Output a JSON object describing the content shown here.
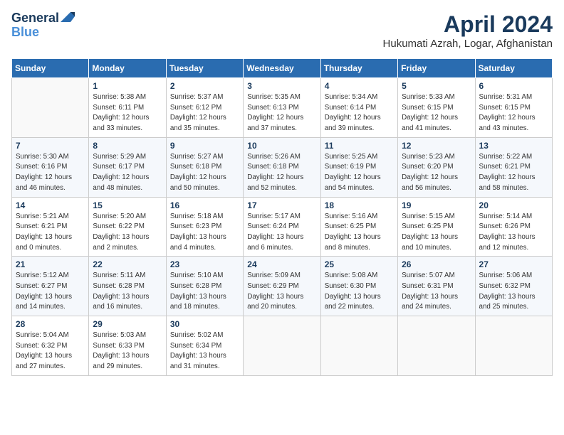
{
  "logo": {
    "line1": "General",
    "line2": "Blue"
  },
  "title": "April 2024",
  "location": "Hukumati Azrah, Logar, Afghanistan",
  "weekdays": [
    "Sunday",
    "Monday",
    "Tuesday",
    "Wednesday",
    "Thursday",
    "Friday",
    "Saturday"
  ],
  "weeks": [
    [
      {
        "day": "",
        "info": ""
      },
      {
        "day": "1",
        "info": "Sunrise: 5:38 AM\nSunset: 6:11 PM\nDaylight: 12 hours\nand 33 minutes."
      },
      {
        "day": "2",
        "info": "Sunrise: 5:37 AM\nSunset: 6:12 PM\nDaylight: 12 hours\nand 35 minutes."
      },
      {
        "day": "3",
        "info": "Sunrise: 5:35 AM\nSunset: 6:13 PM\nDaylight: 12 hours\nand 37 minutes."
      },
      {
        "day": "4",
        "info": "Sunrise: 5:34 AM\nSunset: 6:14 PM\nDaylight: 12 hours\nand 39 minutes."
      },
      {
        "day": "5",
        "info": "Sunrise: 5:33 AM\nSunset: 6:15 PM\nDaylight: 12 hours\nand 41 minutes."
      },
      {
        "day": "6",
        "info": "Sunrise: 5:31 AM\nSunset: 6:15 PM\nDaylight: 12 hours\nand 43 minutes."
      }
    ],
    [
      {
        "day": "7",
        "info": "Sunrise: 5:30 AM\nSunset: 6:16 PM\nDaylight: 12 hours\nand 46 minutes."
      },
      {
        "day": "8",
        "info": "Sunrise: 5:29 AM\nSunset: 6:17 PM\nDaylight: 12 hours\nand 48 minutes."
      },
      {
        "day": "9",
        "info": "Sunrise: 5:27 AM\nSunset: 6:18 PM\nDaylight: 12 hours\nand 50 minutes."
      },
      {
        "day": "10",
        "info": "Sunrise: 5:26 AM\nSunset: 6:18 PM\nDaylight: 12 hours\nand 52 minutes."
      },
      {
        "day": "11",
        "info": "Sunrise: 5:25 AM\nSunset: 6:19 PM\nDaylight: 12 hours\nand 54 minutes."
      },
      {
        "day": "12",
        "info": "Sunrise: 5:23 AM\nSunset: 6:20 PM\nDaylight: 12 hours\nand 56 minutes."
      },
      {
        "day": "13",
        "info": "Sunrise: 5:22 AM\nSunset: 6:21 PM\nDaylight: 12 hours\nand 58 minutes."
      }
    ],
    [
      {
        "day": "14",
        "info": "Sunrise: 5:21 AM\nSunset: 6:21 PM\nDaylight: 13 hours\nand 0 minutes."
      },
      {
        "day": "15",
        "info": "Sunrise: 5:20 AM\nSunset: 6:22 PM\nDaylight: 13 hours\nand 2 minutes."
      },
      {
        "day": "16",
        "info": "Sunrise: 5:18 AM\nSunset: 6:23 PM\nDaylight: 13 hours\nand 4 minutes."
      },
      {
        "day": "17",
        "info": "Sunrise: 5:17 AM\nSunset: 6:24 PM\nDaylight: 13 hours\nand 6 minutes."
      },
      {
        "day": "18",
        "info": "Sunrise: 5:16 AM\nSunset: 6:25 PM\nDaylight: 13 hours\nand 8 minutes."
      },
      {
        "day": "19",
        "info": "Sunrise: 5:15 AM\nSunset: 6:25 PM\nDaylight: 13 hours\nand 10 minutes."
      },
      {
        "day": "20",
        "info": "Sunrise: 5:14 AM\nSunset: 6:26 PM\nDaylight: 13 hours\nand 12 minutes."
      }
    ],
    [
      {
        "day": "21",
        "info": "Sunrise: 5:12 AM\nSunset: 6:27 PM\nDaylight: 13 hours\nand 14 minutes."
      },
      {
        "day": "22",
        "info": "Sunrise: 5:11 AM\nSunset: 6:28 PM\nDaylight: 13 hours\nand 16 minutes."
      },
      {
        "day": "23",
        "info": "Sunrise: 5:10 AM\nSunset: 6:28 PM\nDaylight: 13 hours\nand 18 minutes."
      },
      {
        "day": "24",
        "info": "Sunrise: 5:09 AM\nSunset: 6:29 PM\nDaylight: 13 hours\nand 20 minutes."
      },
      {
        "day": "25",
        "info": "Sunrise: 5:08 AM\nSunset: 6:30 PM\nDaylight: 13 hours\nand 22 minutes."
      },
      {
        "day": "26",
        "info": "Sunrise: 5:07 AM\nSunset: 6:31 PM\nDaylight: 13 hours\nand 24 minutes."
      },
      {
        "day": "27",
        "info": "Sunrise: 5:06 AM\nSunset: 6:32 PM\nDaylight: 13 hours\nand 25 minutes."
      }
    ],
    [
      {
        "day": "28",
        "info": "Sunrise: 5:04 AM\nSunset: 6:32 PM\nDaylight: 13 hours\nand 27 minutes."
      },
      {
        "day": "29",
        "info": "Sunrise: 5:03 AM\nSunset: 6:33 PM\nDaylight: 13 hours\nand 29 minutes."
      },
      {
        "day": "30",
        "info": "Sunrise: 5:02 AM\nSunset: 6:34 PM\nDaylight: 13 hours\nand 31 minutes."
      },
      {
        "day": "",
        "info": ""
      },
      {
        "day": "",
        "info": ""
      },
      {
        "day": "",
        "info": ""
      },
      {
        "day": "",
        "info": ""
      }
    ]
  ]
}
